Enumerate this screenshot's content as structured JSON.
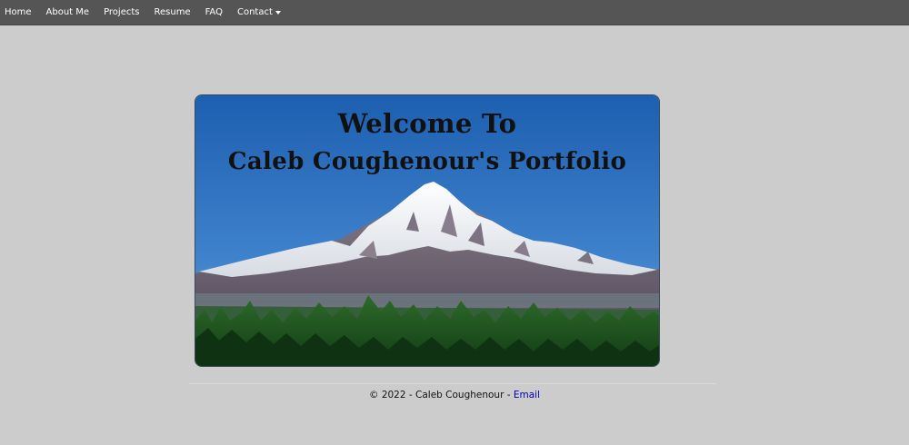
{
  "nav": {
    "items": [
      {
        "label": "Home"
      },
      {
        "label": "About Me"
      },
      {
        "label": "Projects"
      },
      {
        "label": "Resume"
      },
      {
        "label": "FAQ"
      },
      {
        "label": "Contact",
        "dropdown": true
      }
    ]
  },
  "hero": {
    "line1": "Welcome To",
    "line2": "Caleb Coughenour's Portfolio",
    "image": "mountain-landscape"
  },
  "footer": {
    "copyright": "© 2022 - Caleb Coughenour -",
    "email_label": "Email"
  },
  "colors": {
    "navbar": "#555555",
    "page_background": "#cccccc",
    "link": "#0000aa"
  }
}
